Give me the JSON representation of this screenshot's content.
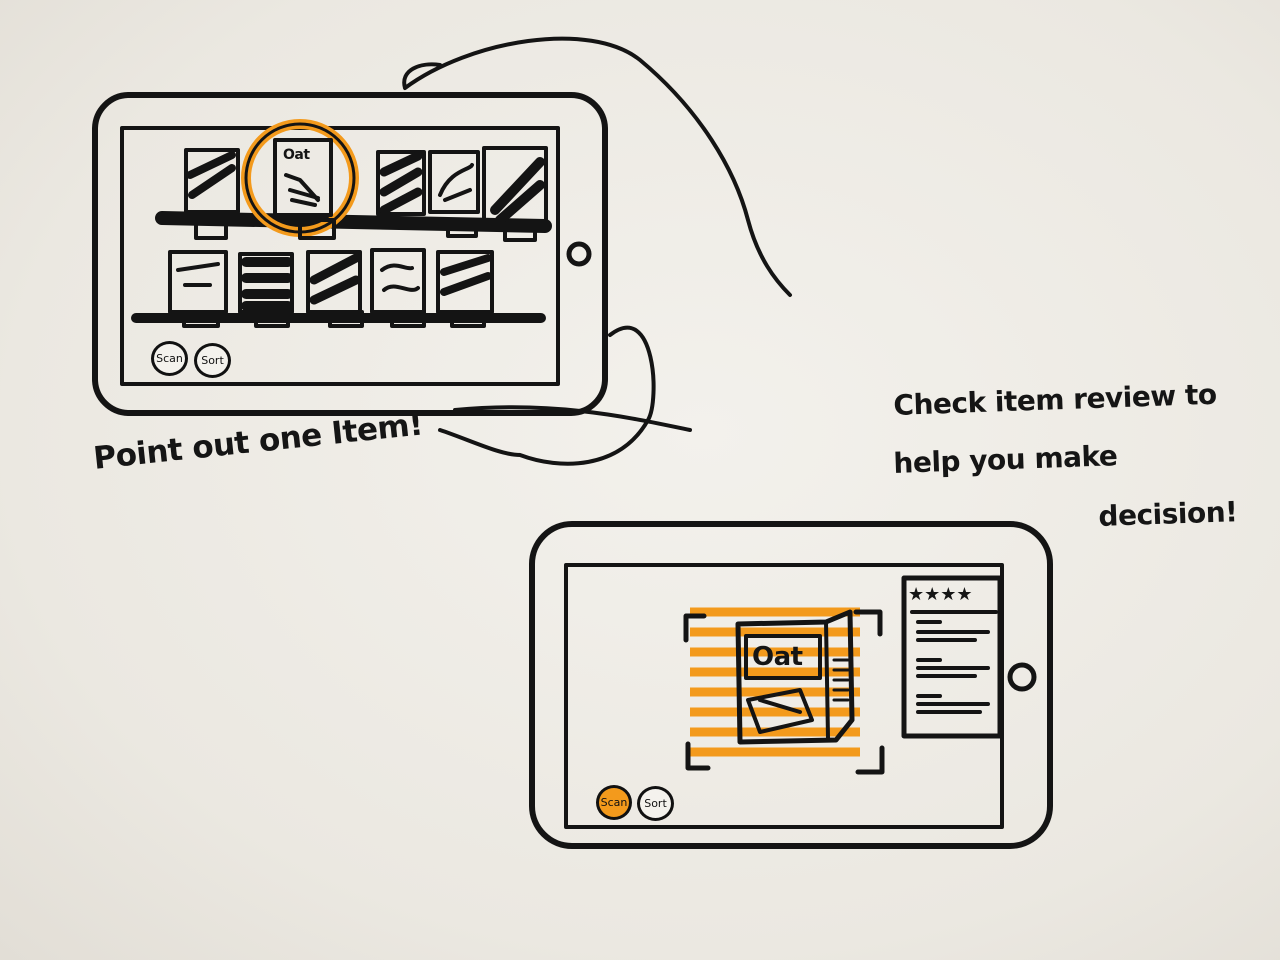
{
  "annotations": {
    "point_out": "Point out one Item!",
    "review_line1": "Check item review to",
    "review_line2": "help you make",
    "review_line3": "decision!"
  },
  "screen1": {
    "scan_label": "Scan",
    "sort_label": "Sort",
    "highlighted_product_label": "Oat"
  },
  "screen2": {
    "scan_label": "Scan",
    "sort_label": "Sort",
    "product_label": "Oat",
    "review_stars": "★★★★",
    "active_button": "Scan"
  },
  "colors": {
    "ink": "#141414",
    "accent": "#f39a1c",
    "paper": "#f1efea"
  }
}
